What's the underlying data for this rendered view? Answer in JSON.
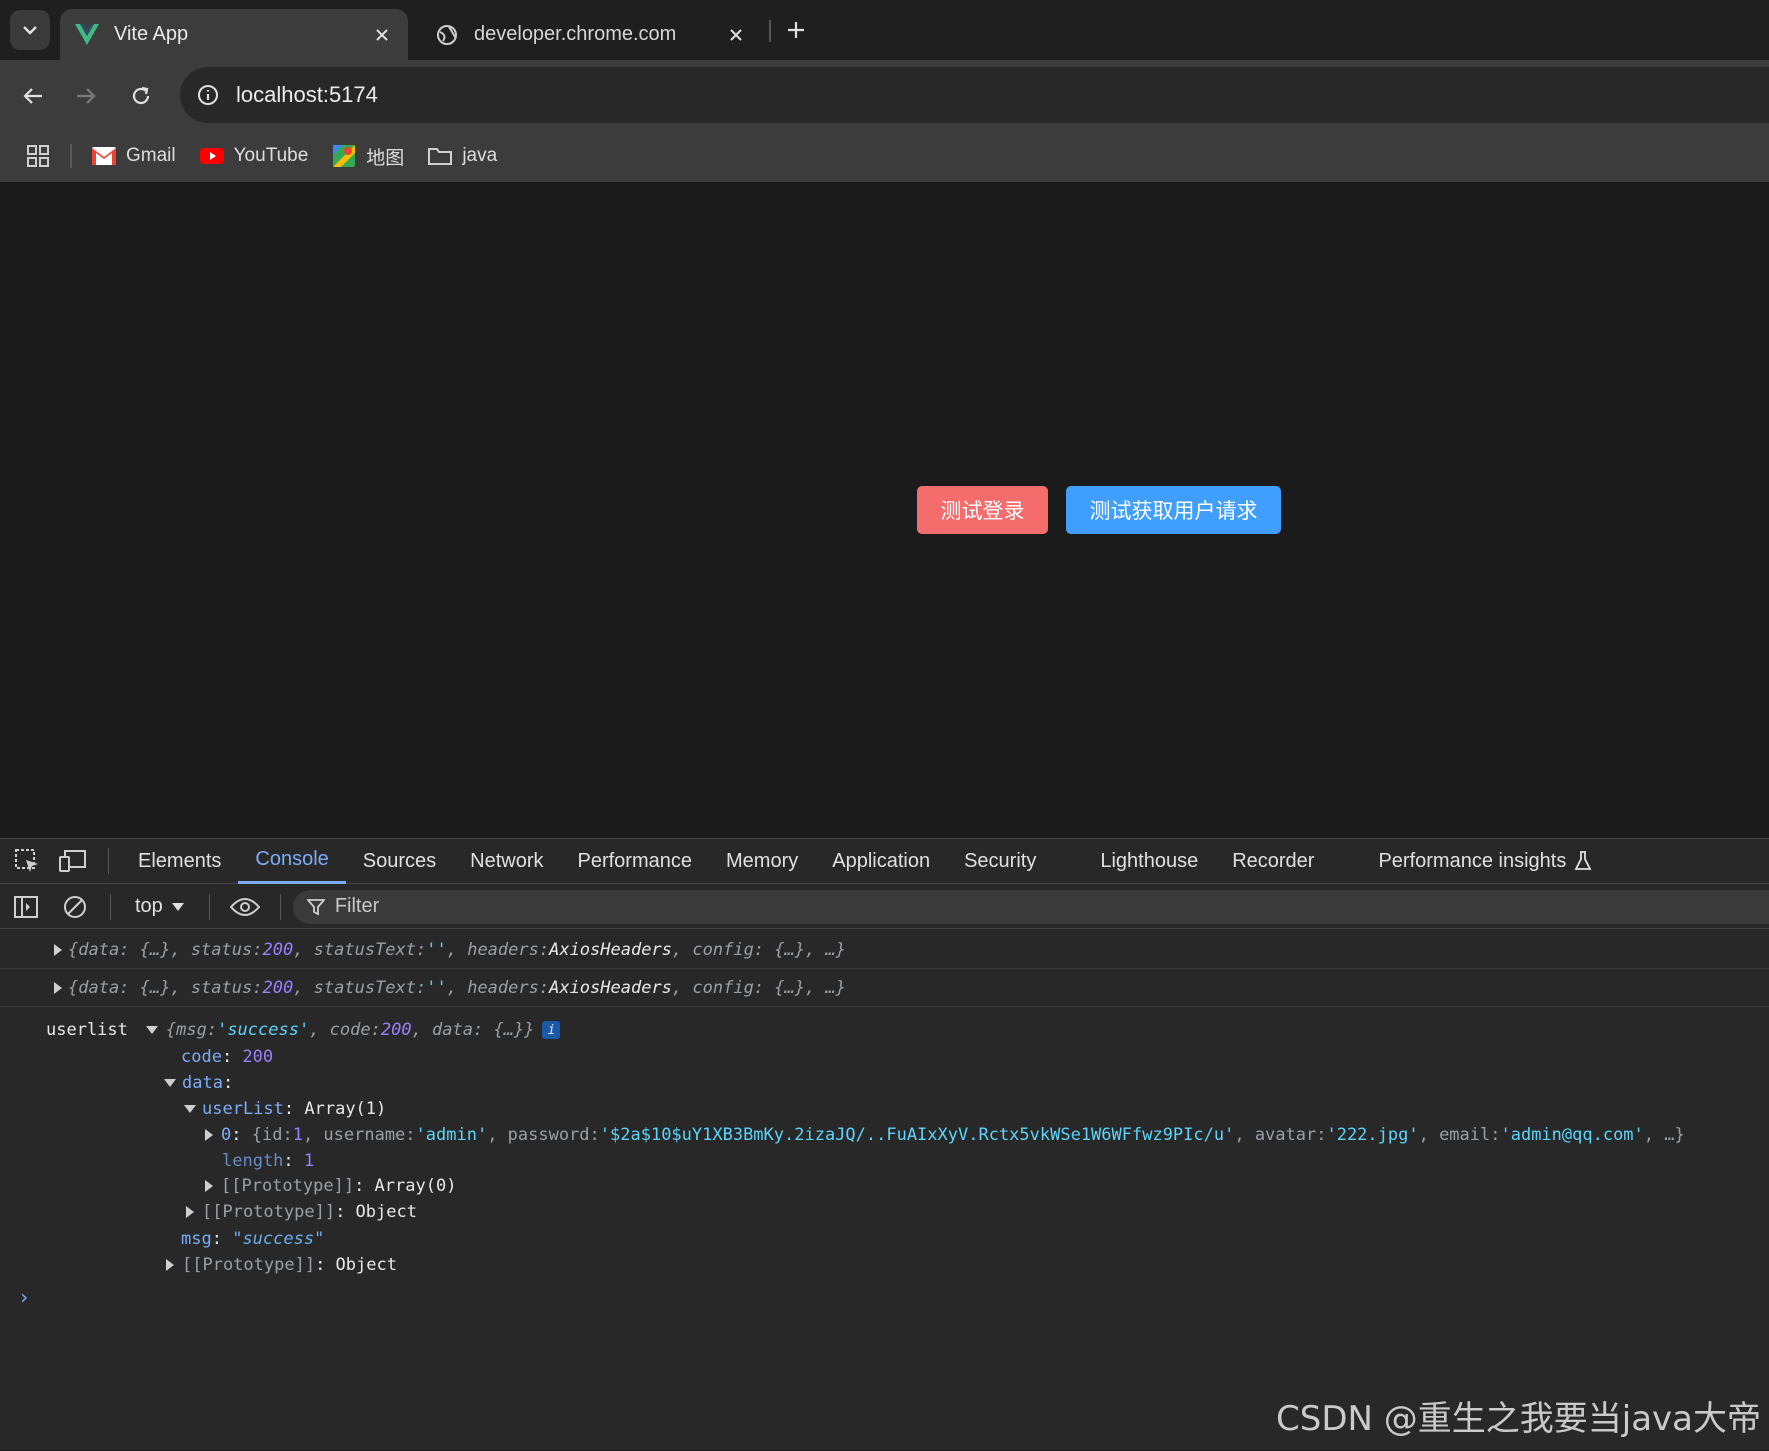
{
  "browser": {
    "tabs": [
      {
        "title": "Vite App",
        "favicon": "vue-logo-icon",
        "active": true
      },
      {
        "title": "developer.chrome.com",
        "favicon": "globe-icon",
        "active": false
      }
    ],
    "address": "localhost:5174",
    "bookmarks": [
      {
        "label": "Gmail",
        "icon": "gmail-icon"
      },
      {
        "label": "YouTube",
        "icon": "youtube-icon"
      },
      {
        "label": "地图",
        "icon": "maps-icon"
      },
      {
        "label": "java",
        "icon": "folder-icon"
      }
    ]
  },
  "page": {
    "login_button": "测试登录",
    "users_button": "测试获取用户请求",
    "colors": {
      "login": "#f56c6c",
      "users": "#409eff"
    }
  },
  "devtools": {
    "tabs": [
      "Elements",
      "Console",
      "Sources",
      "Network",
      "Performance",
      "Memory",
      "Application",
      "Security",
      "Lighthouse",
      "Recorder",
      "Performance insights"
    ],
    "active_tab": "Console",
    "context": "top",
    "filter_placeholder": "Filter",
    "console": {
      "log1": {
        "p1": "{data: {…}, status: ",
        "status": "200",
        "p2": ", statusText: ",
        "statusText": "''",
        "p3": ", headers: ",
        "headers": "AxiosHeaders",
        "p4": ", config: {…},  …}"
      },
      "log2": {
        "p1": "{data: {…}, status: ",
        "status": "200",
        "p2": ", statusText: ",
        "statusText": "''",
        "p3": ", headers: ",
        "headers": "AxiosHeaders",
        "p4": ", config: {…},  …}"
      },
      "userlist": {
        "label": "userlist",
        "summary_a": "{msg: ",
        "summary_msg": "'success'",
        "summary_b": ", code: ",
        "summary_code": "200",
        "summary_c": ", data: {…}}",
        "code_key": "code",
        "code_val": "200",
        "data_key": "data",
        "userList_key": "userList",
        "userList_val": "Array(1)",
        "item0_key": "0",
        "item0_a": "{id: ",
        "item0_id": "1",
        "item0_b": ", username: ",
        "item0_username": "'admin'",
        "item0_c": ", password: ",
        "item0_password": "'$2a$10$uY1XB3BmKy.2izaJQ/..FuAIxXyV.Rctx5vkWSe1W6WFfwz9PIc/u'",
        "item0_d": ", avatar: ",
        "item0_avatar": "'222.jpg'",
        "item0_e": ", email: ",
        "item0_email": "'admin@qq.com'",
        "item0_f": ",  …}",
        "length_key": "length",
        "length_val": "1",
        "proto_array_key": "[[Prototype]]",
        "proto_array_val": "Array(0)",
        "proto_obj_key": "[[Prototype]]",
        "proto_obj_val": "Object",
        "msg_key": "msg",
        "msg_val": "\"success\"",
        "proto_root_key": "[[Prototype]]",
        "proto_root_val": "Object"
      }
    }
  },
  "watermark": "CSDN @重生之我要当java大帝"
}
